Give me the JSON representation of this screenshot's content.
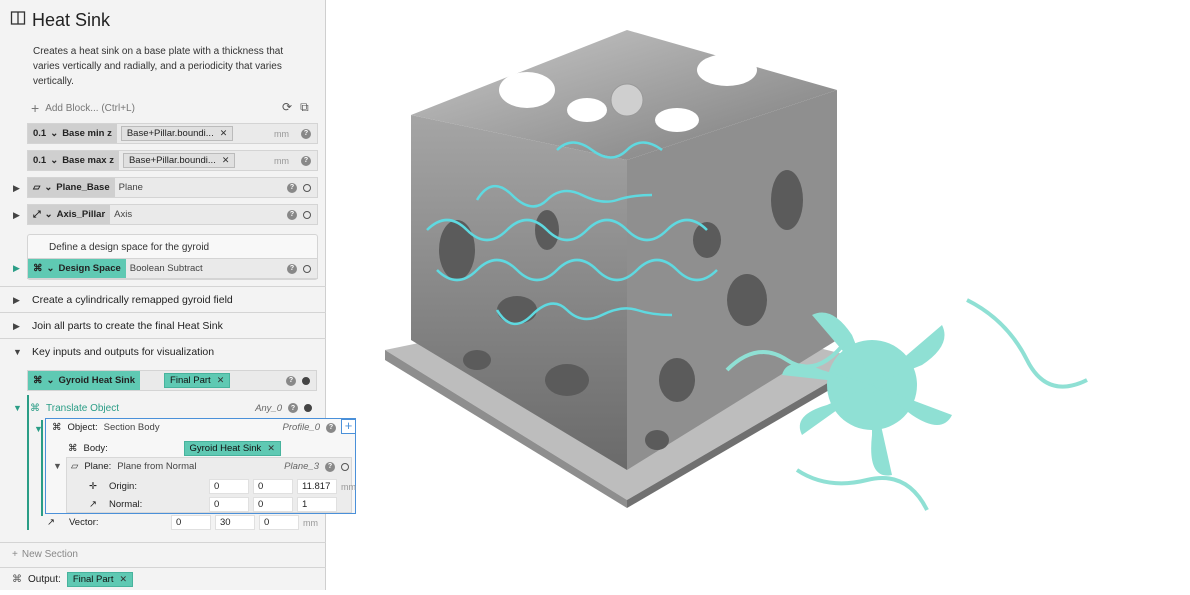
{
  "panel": {
    "title": "Heat Sink",
    "description": "Creates a heat sink on a base plate with a thickness that varies vertically and radially, and a periodicity that varies vertically.",
    "add_block": "Add Block... (Ctrl+L)",
    "rows": {
      "base_min": {
        "label": "Base min z",
        "chip": "Base+Pillar.boundi...",
        "unit": "mm"
      },
      "base_max": {
        "label": "Base max z",
        "chip": "Base+Pillar.boundi...",
        "unit": "mm"
      },
      "plane_base": {
        "label": "Plane_Base",
        "value": "Plane"
      },
      "axis_pillar": {
        "label": "Axis_Pillar",
        "value": "Axis"
      },
      "note": "Define a design space for the gyroid",
      "design_space": {
        "label": "Design Space",
        "value": "Boolean Subtract"
      }
    },
    "sections": [
      "Create a cylindrically remapped gyroid field",
      "Join all parts to create the final Heat Sink",
      "Key inputs and outputs for visualization"
    ],
    "gyroid_row": {
      "label": "Gyroid Heat Sink",
      "chip": "Final Part"
    },
    "translate": {
      "label": "Translate Object",
      "type": "Any_0",
      "object_label": "Object:",
      "object_value": "Section Body",
      "object_type": "Profile_0",
      "body_label": "Body:",
      "body_chip": "Gyroid Heat Sink",
      "plane_label": "Plane:",
      "plane_value": "Plane from Normal",
      "plane_type": "Plane_3",
      "origin_label": "Origin:",
      "origin": [
        "0",
        "0",
        "11.817"
      ],
      "normal_label": "Normal:",
      "normal": [
        "0",
        "0",
        "1"
      ],
      "vector_label": "Vector:",
      "vector": [
        "0",
        "30",
        "0"
      ],
      "unit": "mm"
    },
    "new_section": "New Section",
    "output_label": "Output:",
    "output_chip": "Final Part"
  },
  "colors": {
    "accent": "#5fc9b3",
    "selection": "#4a90d9",
    "cyan": "#5fd9e0"
  }
}
